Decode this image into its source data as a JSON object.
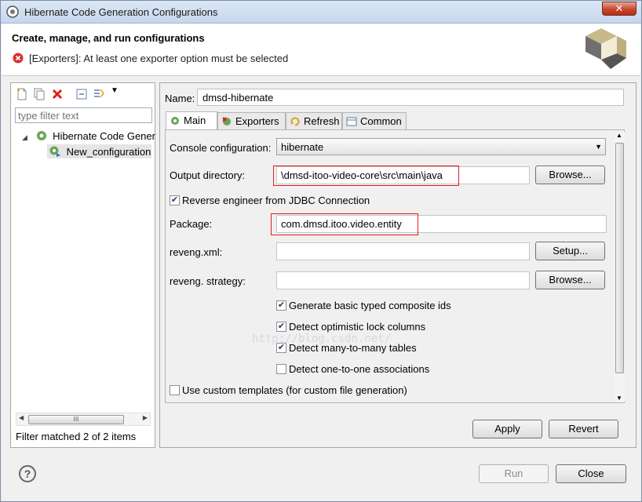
{
  "window": {
    "title": "Hibernate Code Generation Configurations",
    "close_label": "✕"
  },
  "header": {
    "title": "Create, manage, and run configurations",
    "message": "[Exporters]: At least one exporter option must be selected"
  },
  "left": {
    "filter_placeholder": "type filter text",
    "tree": {
      "root": "Hibernate Code Gener",
      "child": "New_configuration"
    },
    "scroll_grip": "III",
    "status": "Filter matched 2 of 2 items"
  },
  "form": {
    "name_label": "Name:",
    "name_value": "dmsd-hibernate",
    "tabs": [
      "Main",
      "Exporters",
      "Refresh",
      "Common"
    ],
    "console_label": "Console configuration:",
    "console_value": "hibernate",
    "output_label": "Output directory:",
    "output_value": "\\dmsd-itoo-video-core\\src\\main\\java",
    "reverse_label": "Reverse engineer from JDBC Connection",
    "package_label": "Package:",
    "package_value": "com.dmsd.itoo.video.entity",
    "reveng_xml_label": "reveng.xml:",
    "reveng_strategy_label": "reveng. strategy:",
    "browse_label": "Browse...",
    "setup_label": "Setup...",
    "options": [
      "Generate basic typed composite ids",
      "Detect optimistic lock columns",
      "Detect many-to-many tables",
      "Detect one-to-one associations"
    ],
    "custom_templates_label": "Use custom templates (for custom file generation)",
    "watermark": "http://blog.csdn.net/"
  },
  "buttons": {
    "apply": "Apply",
    "revert": "Revert",
    "run": "Run",
    "close": "Close",
    "help": "?"
  },
  "colors": {
    "accent_red": "#e02020",
    "check": "#1f3b68"
  }
}
